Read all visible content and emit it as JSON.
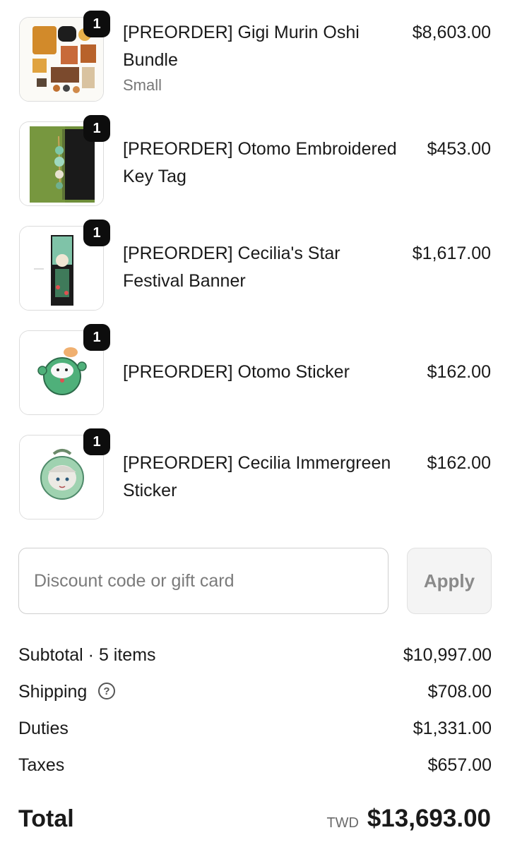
{
  "items": [
    {
      "quantity": "1",
      "name": "[PREORDER] Gigi Murin Oshi Bundle",
      "variant": "Small",
      "price": "$8,603.00",
      "thumb_icon": "oshi-bundle-image"
    },
    {
      "quantity": "1",
      "name": "[PREORDER] Otomo Embroidered Key Tag",
      "variant": "",
      "price": "$453.00",
      "thumb_icon": "key-tag-image"
    },
    {
      "quantity": "1",
      "name": "[PREORDER] Cecilia's Star Festival Banner",
      "variant": "",
      "price": "$1,617.00",
      "thumb_icon": "banner-image"
    },
    {
      "quantity": "1",
      "name": "[PREORDER] Otomo Sticker",
      "variant": "",
      "price": "$162.00",
      "thumb_icon": "otomo-sticker-image"
    },
    {
      "quantity": "1",
      "name": "[PREORDER] Cecilia Immergreen Sticker",
      "variant": "",
      "price": "$162.00",
      "thumb_icon": "cecilia-sticker-image"
    }
  ],
  "discount": {
    "placeholder": "Discount code or gift card",
    "apply_label": "Apply"
  },
  "summary": {
    "subtotal_label": "Subtotal · 5 items",
    "subtotal_value": "$10,997.00",
    "shipping_label": "Shipping",
    "shipping_value": "$708.00",
    "duties_label": "Duties",
    "duties_value": "$1,331.00",
    "taxes_label": "Taxes",
    "taxes_value": "$657.00",
    "help_icon": "question-circle-icon"
  },
  "total": {
    "label": "Total",
    "currency": "TWD",
    "value": "$13,693.00"
  }
}
